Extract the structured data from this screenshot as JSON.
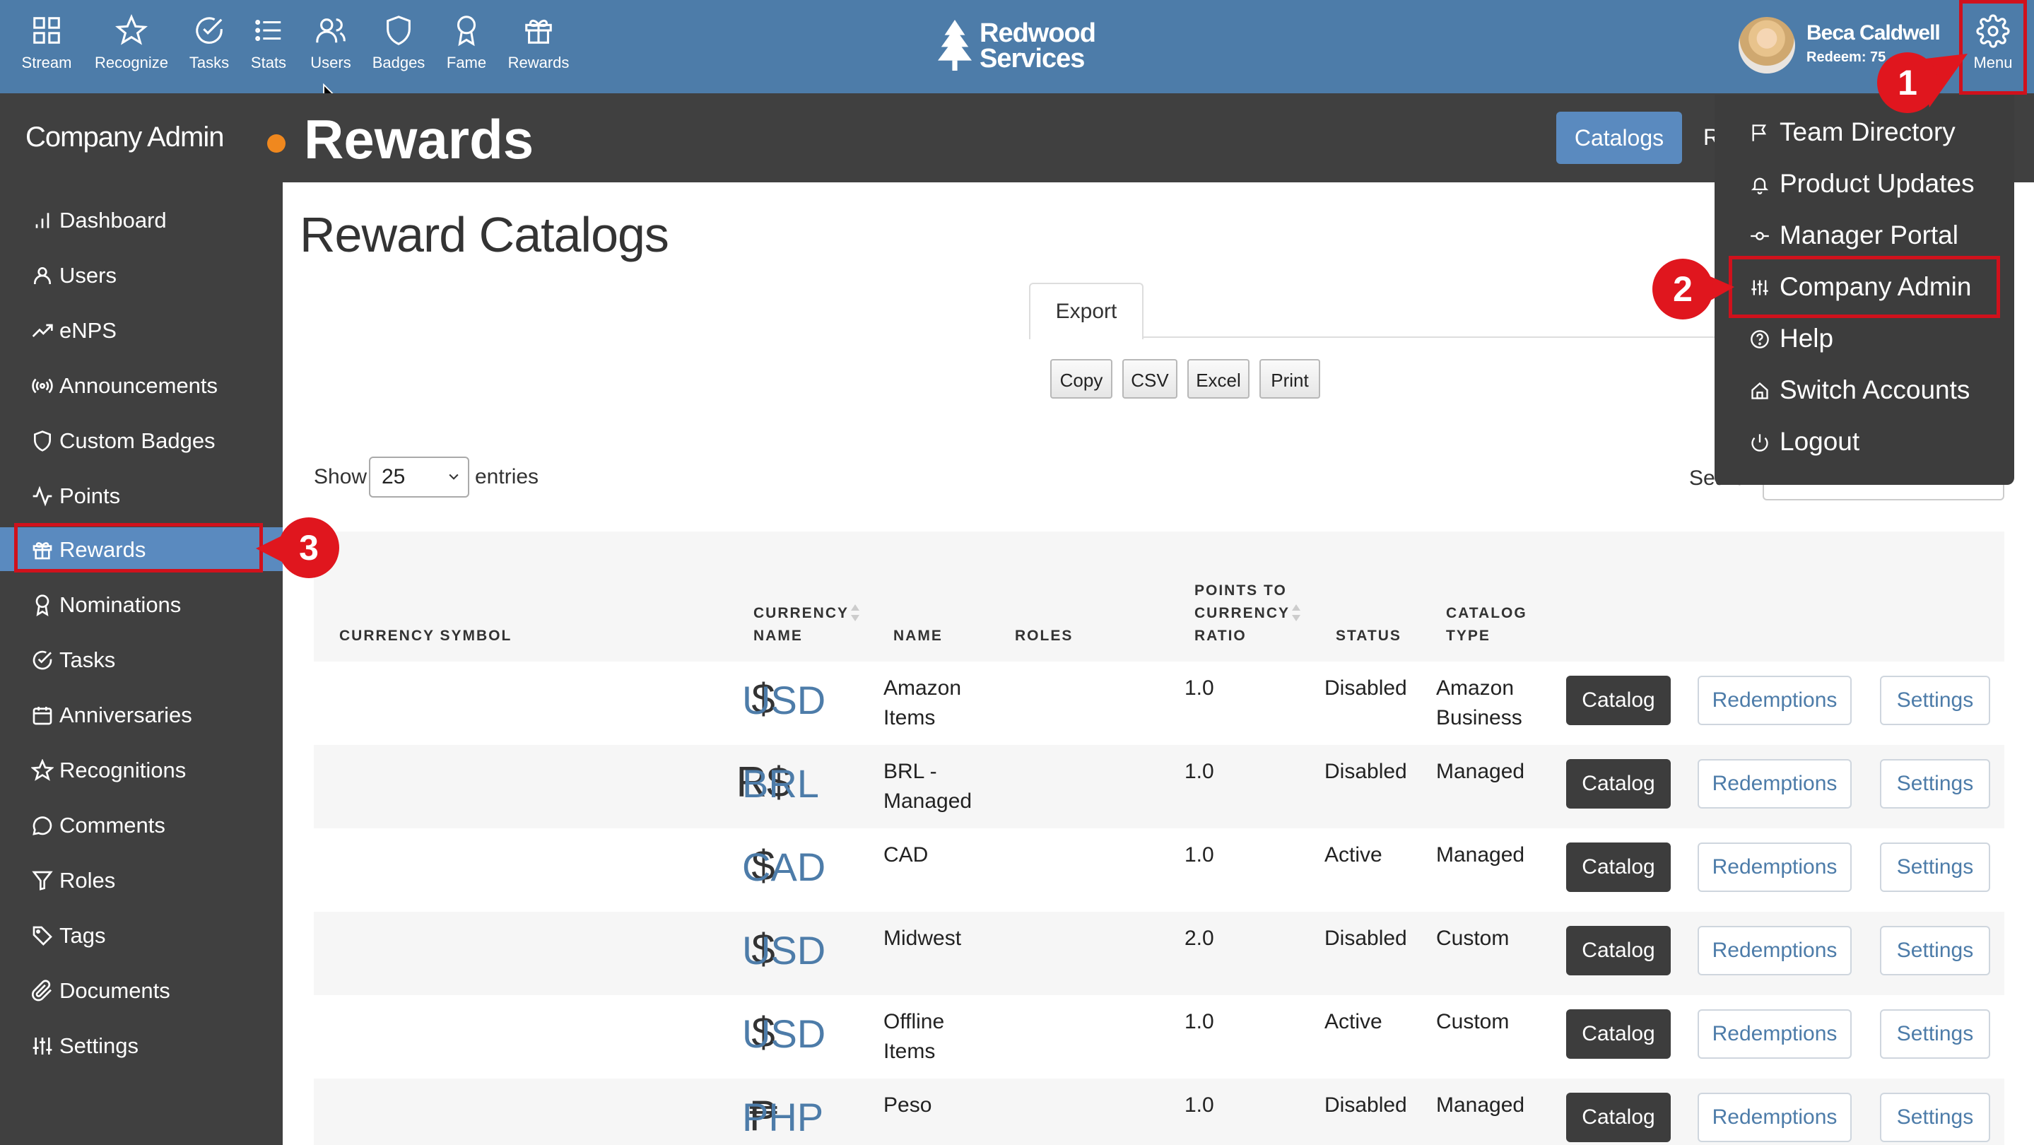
{
  "nav": {
    "items": [
      {
        "label": "Stream",
        "icon": "grid-icon"
      },
      {
        "label": "Recognize",
        "icon": "star-icon"
      },
      {
        "label": "Tasks",
        "icon": "check-circle-icon"
      },
      {
        "label": "Stats",
        "icon": "list-icon"
      },
      {
        "label": "Users",
        "icon": "users-icon"
      },
      {
        "label": "Badges",
        "icon": "shield-icon"
      },
      {
        "label": "Fame",
        "icon": "award-icon"
      },
      {
        "label": "Rewards",
        "icon": "gift-icon"
      }
    ],
    "logo_line1": "Redwood",
    "logo_line2": "Services",
    "user_name": "Beca Caldwell",
    "user_redeem": "Redeem: 75",
    "menu_label": "Menu"
  },
  "header": {
    "sidebar_title": "Company Admin",
    "page_title": "Rewards",
    "tab_active": "Catalogs",
    "tab_partial": "R"
  },
  "sidebar": {
    "items": [
      {
        "label": "Dashboard",
        "icon": "bar-chart-icon"
      },
      {
        "label": "Users",
        "icon": "user-icon"
      },
      {
        "label": "eNPS",
        "icon": "trending-up-icon"
      },
      {
        "label": "Announcements",
        "icon": "broadcast-icon"
      },
      {
        "label": "Custom Badges",
        "icon": "shield-icon"
      },
      {
        "label": "Points",
        "icon": "activity-icon"
      },
      {
        "label": "Rewards",
        "icon": "gift-icon"
      },
      {
        "label": "Nominations",
        "icon": "award-icon"
      },
      {
        "label": "Tasks",
        "icon": "check-circle-icon"
      },
      {
        "label": "Anniversaries",
        "icon": "calendar-icon"
      },
      {
        "label": "Recognitions",
        "icon": "star-icon"
      },
      {
        "label": "Comments",
        "icon": "comment-icon"
      },
      {
        "label": "Roles",
        "icon": "filter-icon"
      },
      {
        "label": "Tags",
        "icon": "tag-icon"
      },
      {
        "label": "Documents",
        "icon": "paperclip-icon"
      },
      {
        "label": "Settings",
        "icon": "sliders-icon"
      }
    ],
    "active": "Rewards"
  },
  "dropdown": {
    "items": [
      {
        "label": "Team Directory",
        "icon": "flag-icon"
      },
      {
        "label": "Product Updates",
        "icon": "bell-icon"
      },
      {
        "label": "Manager Portal",
        "icon": "commit-icon"
      },
      {
        "label": "Company Admin",
        "icon": "sliders-icon"
      },
      {
        "label": "Help",
        "icon": "help-circle-icon"
      },
      {
        "label": "Switch Accounts",
        "icon": "home-icon"
      },
      {
        "label": "Logout",
        "icon": "power-icon"
      }
    ]
  },
  "content": {
    "title": "Reward Catalogs",
    "export_tab": "Export",
    "export_buttons": [
      "Copy",
      "CSV",
      "Excel",
      "Print"
    ],
    "show_label": "Show",
    "show_value": "25",
    "entries_label": "entries",
    "search_label": "Search:"
  },
  "table": {
    "headers": {
      "currency_symbol": "CURRENCY SYMBOL",
      "currency_name_1": "CURRENCY",
      "currency_name_2": "NAME",
      "name": "NAME",
      "roles": "ROLES",
      "ratio_1": "POINTS TO",
      "ratio_2": "CURRENCY",
      "ratio_3": "RATIO",
      "status": "STATUS",
      "catalog_type_1": "CATALOG",
      "catalog_type_2": "TYPE"
    },
    "rows": [
      {
        "symbol": "$",
        "currency": "USD",
        "name1": "Amazon",
        "name2": "Items",
        "roles": "",
        "ratio": "1.0",
        "status": "Disabled",
        "type1": "Amazon",
        "type2": "Business"
      },
      {
        "symbol": "R$",
        "currency": "BRL",
        "name1": "BRL -",
        "name2": "Managed",
        "roles": "",
        "ratio": "1.0",
        "status": "Disabled",
        "type1": "Managed",
        "type2": ""
      },
      {
        "symbol": "$",
        "currency": "CAD",
        "name1": "CAD",
        "name2": "",
        "roles": "",
        "ratio": "1.0",
        "status": "Active",
        "type1": "Managed",
        "type2": ""
      },
      {
        "symbol": "$",
        "currency": "USD",
        "name1": "Midwest",
        "name2": "",
        "roles": "",
        "ratio": "2.0",
        "status": "Disabled",
        "type1": "Custom",
        "type2": ""
      },
      {
        "symbol": "$",
        "currency": "USD",
        "name1": "Offline",
        "name2": "Items",
        "roles": "",
        "ratio": "1.0",
        "status": "Active",
        "type1": "Custom",
        "type2": ""
      },
      {
        "symbol": "₱",
        "currency": "PHP",
        "name1": "Peso",
        "name2": "",
        "roles": "",
        "ratio": "1.0",
        "status": "Disabled",
        "type1": "Managed",
        "type2": ""
      }
    ],
    "buttons": {
      "catalog": "Catalog",
      "redemptions": "Redemptions",
      "settings": "Settings"
    }
  },
  "annotations": {
    "step1": "1",
    "step2": "2",
    "step3": "3",
    "highlight_color": "#d0111c"
  },
  "colors": {
    "brand_blue": "#4d7ca9",
    "dark": "#404040",
    "accent_orange": "#f0881e"
  }
}
